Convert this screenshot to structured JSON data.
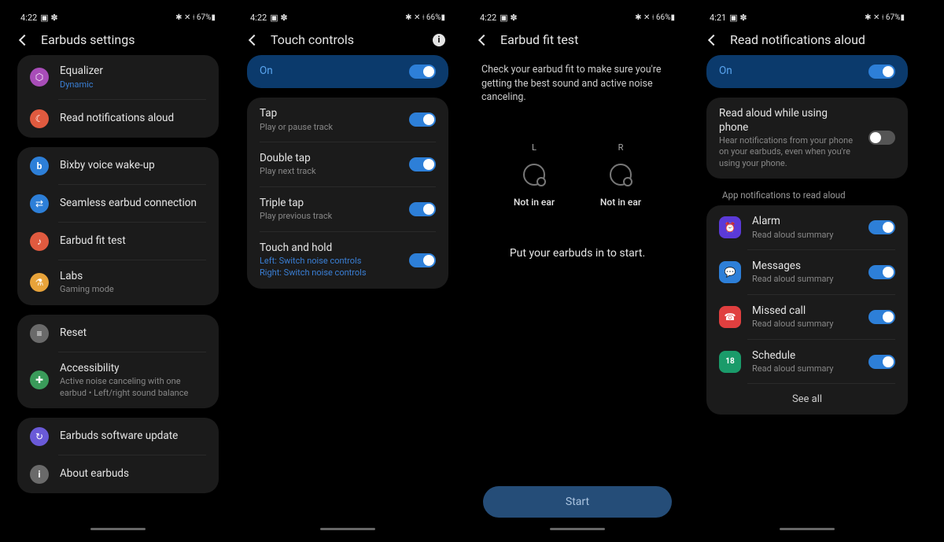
{
  "screens": {
    "s1": {
      "status": {
        "time": "4:22",
        "icons": "▣ ✽",
        "right": "✱ ✕ ⟊ 67%▮"
      },
      "title": "Earbuds settings",
      "groups": [
        {
          "items": [
            {
              "icon": "eq",
              "title": "Equalizer",
              "sub": "Dynamic",
              "subBlue": true
            },
            {
              "icon": "notif",
              "title": "Read notifications aloud"
            }
          ]
        },
        {
          "items": [
            {
              "icon": "bixby",
              "title": "Bixby voice wake-up"
            },
            {
              "icon": "seamless",
              "title": "Seamless earbud connection"
            },
            {
              "icon": "fit",
              "title": "Earbud fit test"
            },
            {
              "icon": "labs",
              "title": "Labs",
              "sub": "Gaming mode"
            }
          ]
        },
        {
          "items": [
            {
              "icon": "reset",
              "title": "Reset"
            },
            {
              "icon": "acc",
              "title": "Accessibility",
              "sub": "Active noise canceling with one earbud  •  Left/right sound balance"
            }
          ]
        },
        {
          "items": [
            {
              "icon": "update",
              "title": "Earbuds software update"
            },
            {
              "icon": "about",
              "title": "About earbuds"
            }
          ]
        }
      ]
    },
    "s2": {
      "status": {
        "time": "4:22",
        "icons": "▣ ✽",
        "right": "✱ ✕ ⟊ 66%▮"
      },
      "title": "Touch controls",
      "onLabel": "On",
      "rows": [
        {
          "title": "Tap",
          "sub": "Play or pause track"
        },
        {
          "title": "Double tap",
          "sub": "Play next track"
        },
        {
          "title": "Triple tap",
          "sub": "Play previous track"
        },
        {
          "title": "Touch and hold",
          "sub1": "Left: Switch noise controls",
          "sub2": "Right: Switch noise controls"
        }
      ]
    },
    "s3": {
      "status": {
        "time": "4:22",
        "icons": "▣ ✽",
        "right": "✱ ✕ ⟊ 66%▮"
      },
      "title": "Earbud fit test",
      "desc": "Check your earbud fit to make sure you're getting the best sound and active noise canceling.",
      "left": {
        "label": "L",
        "status": "Not in ear"
      },
      "right": {
        "label": "R",
        "status": "Not in ear"
      },
      "prompt": "Put your earbuds in to start.",
      "startLabel": "Start"
    },
    "s4": {
      "status": {
        "time": "4:21",
        "icons": "▣ ✽",
        "right": "✱ ✕ ⟊ 67%▮"
      },
      "title": "Read notifications aloud",
      "onLabel": "On",
      "readAloud": {
        "title": "Read aloud while using phone",
        "sub": "Hear notifications from your phone on your earbuds, even when you're using your phone."
      },
      "section": "App notifications to read aloud",
      "apps": [
        {
          "icon": "alarm",
          "title": "Alarm",
          "sub": "Read aloud summary"
        },
        {
          "icon": "msg",
          "title": "Messages",
          "sub": "Read aloud summary"
        },
        {
          "icon": "missed",
          "title": "Missed call",
          "sub": "Read aloud summary"
        },
        {
          "icon": "sched",
          "title": "Schedule",
          "sub": "Read aloud summary"
        }
      ],
      "seeAll": "See all"
    }
  },
  "iconColors": {
    "eq": "#a84db8",
    "notif": "#e05a3f",
    "bixby": "#2d7fd8",
    "seamless": "#2d7fd8",
    "fit": "#e05a3f",
    "labs": "#e8a33a",
    "reset": "#6a6a6a",
    "acc": "#3a9b5a",
    "update": "#6a5ad8",
    "about": "#6a6a6a",
    "alarm": "#5b3ad8",
    "msg": "#2d7fd8",
    "missed": "#e03f3f",
    "sched": "#1a9b6a"
  },
  "iconGlyphs": {
    "eq": "⬡",
    "notif": "🔔",
    "bixby": "b",
    "seamless": "⇄",
    "fit": "♪",
    "labs": "⚗",
    "reset": "≡",
    "acc": "✚",
    "update": "↻",
    "about": "i",
    "alarm": "⏰",
    "msg": "💬",
    "missed": "☎",
    "sched": "18"
  }
}
